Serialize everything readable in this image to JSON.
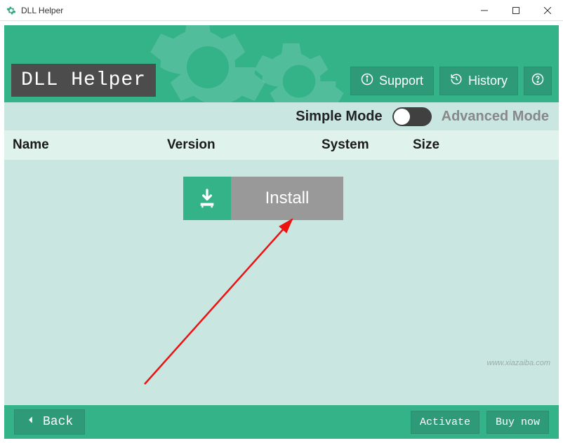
{
  "window": {
    "title": "DLL Helper"
  },
  "header": {
    "logo": "DLL Helper",
    "support_label": "Support",
    "history_label": "History"
  },
  "mode": {
    "simple_label": "Simple Mode",
    "advanced_label": "Advanced Mode",
    "state": "simple"
  },
  "table": {
    "columns": {
      "name": "Name",
      "version": "Version",
      "system": "System",
      "size": "Size"
    }
  },
  "main": {
    "install_label": "Install"
  },
  "footer": {
    "back_label": "Back",
    "activate_label": "Activate",
    "buynow_label": "Buy now"
  },
  "colors": {
    "primary": "#34b288",
    "primary_dark": "#2e9a77",
    "panel": "#c9e7e0",
    "panel_light": "#dff2ec",
    "install_gray": "#9a999a",
    "logo_bg": "#4c4c4c"
  }
}
